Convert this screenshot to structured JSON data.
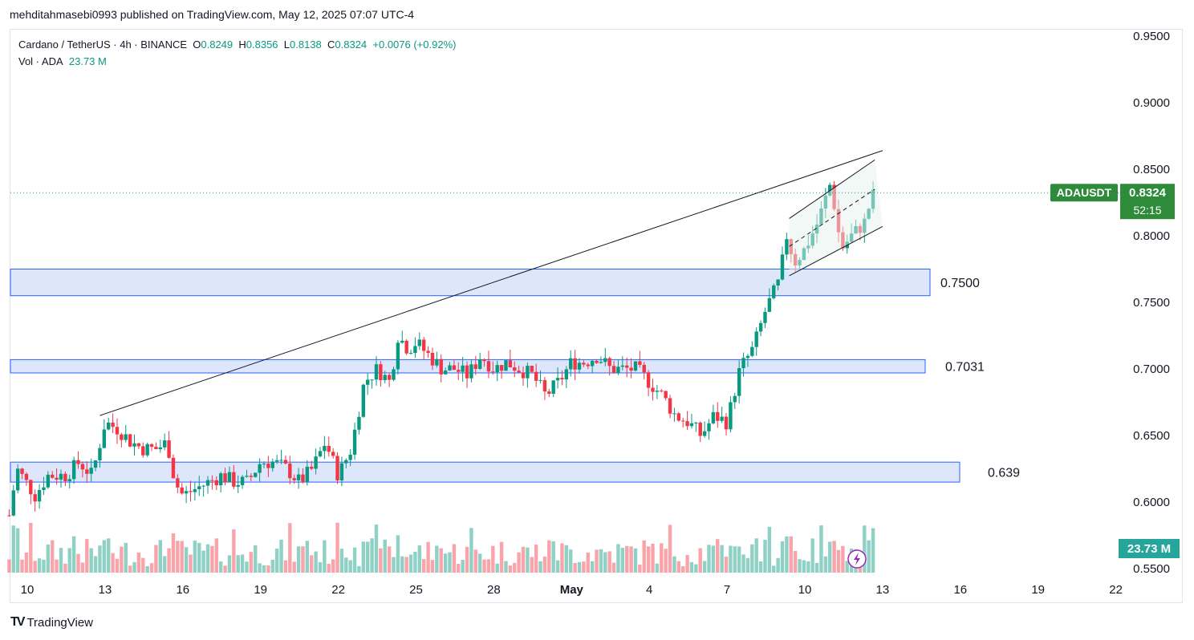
{
  "header": {
    "publisher": "mehditahmasebi0993 published on TradingView.com, May 12, 2025 07:07 UTC-4"
  },
  "legend": {
    "symbol": "Cardano / TetherUS · 4h · BINANCE",
    "o_label": "O",
    "o": "0.8249",
    "h_label": "H",
    "h": "0.8356",
    "l_label": "L",
    "l": "0.8138",
    "c_label": "C",
    "c": "0.8324",
    "change": "+0.0076 (+0.92%)",
    "vol_label": "Vol · ADA",
    "vol": "23.73 M"
  },
  "footer": {
    "brand": "TradingView"
  },
  "colors": {
    "up": "#089981",
    "down": "#f23645",
    "zone_fill": "#d6e0fb",
    "zone_border": "#2962ff",
    "tag": "#2e8b3a"
  },
  "chart_data": {
    "type": "candlestick",
    "symbol": "ADAUSDT",
    "timeframe": "4h",
    "y_ticks": [
      "0.9500",
      "0.9000",
      "0.8500",
      "0.8000",
      "0.7500",
      "0.7000",
      "0.6500",
      "0.6000",
      "0.5500"
    ],
    "ylim": [
      0.55,
      0.955
    ],
    "x_ticks": [
      {
        "label": "10",
        "day": 10
      },
      {
        "label": "13",
        "day": 13
      },
      {
        "label": "16",
        "day": 16
      },
      {
        "label": "19",
        "day": 19
      },
      {
        "label": "22",
        "day": 22
      },
      {
        "label": "25",
        "day": 25
      },
      {
        "label": "28",
        "day": 28
      },
      {
        "label": "May",
        "day": 31
      },
      {
        "label": "4",
        "day": 34
      },
      {
        "label": "7",
        "day": 37
      },
      {
        "label": "10",
        "day": 40
      },
      {
        "label": "13",
        "day": 43
      },
      {
        "label": "16",
        "day": 46
      },
      {
        "label": "19",
        "day": 49
      },
      {
        "label": "22",
        "day": 52
      }
    ],
    "price_anchors": [
      [
        9.3,
        0.59
      ],
      [
        9.6,
        0.625
      ],
      [
        10.3,
        0.605
      ],
      [
        10.8,
        0.62
      ],
      [
        11.5,
        0.62
      ],
      [
        12,
        0.63
      ],
      [
        12.5,
        0.62
      ],
      [
        13,
        0.66
      ],
      [
        13.5,
        0.655
      ],
      [
        14,
        0.645
      ],
      [
        14.5,
        0.64
      ],
      [
        15,
        0.64
      ],
      [
        15.4,
        0.645
      ],
      [
        15.7,
        0.615
      ],
      [
        16,
        0.605
      ],
      [
        16.5,
        0.61
      ],
      [
        17,
        0.615
      ],
      [
        17.5,
        0.62
      ],
      [
        18,
        0.615
      ],
      [
        18.5,
        0.615
      ],
      [
        19,
        0.63
      ],
      [
        19.5,
        0.63
      ],
      [
        20,
        0.625
      ],
      [
        20.5,
        0.615
      ],
      [
        21,
        0.625
      ],
      [
        21.5,
        0.645
      ],
      [
        22,
        0.62
      ],
      [
        22.5,
        0.64
      ],
      [
        23,
        0.69
      ],
      [
        23.5,
        0.7
      ],
      [
        24,
        0.69
      ],
      [
        24.3,
        0.725
      ],
      [
        24.7,
        0.715
      ],
      [
        25,
        0.72
      ],
      [
        25.5,
        0.71
      ],
      [
        26,
        0.7
      ],
      [
        26.5,
        0.7
      ],
      [
        27,
        0.695
      ],
      [
        27.5,
        0.71
      ],
      [
        28,
        0.7
      ],
      [
        28.5,
        0.705
      ],
      [
        29,
        0.7
      ],
      [
        29.5,
        0.695
      ],
      [
        30,
        0.68
      ],
      [
        30.5,
        0.69
      ],
      [
        31,
        0.705
      ],
      [
        31.5,
        0.705
      ],
      [
        32,
        0.71
      ],
      [
        32.5,
        0.7
      ],
      [
        33,
        0.7
      ],
      [
        33.5,
        0.7
      ],
      [
        34,
        0.69
      ],
      [
        34.5,
        0.68
      ],
      [
        35,
        0.665
      ],
      [
        35.5,
        0.66
      ],
      [
        36,
        0.65
      ],
      [
        36.5,
        0.665
      ],
      [
        37,
        0.66
      ],
      [
        37.5,
        0.7
      ],
      [
        38,
        0.715
      ],
      [
        38.5,
        0.745
      ],
      [
        39,
        0.765
      ],
      [
        39.3,
        0.8
      ],
      [
        39.6,
        0.78
      ],
      [
        40,
        0.79
      ],
      [
        40.5,
        0.81
      ],
      [
        41,
        0.84
      ],
      [
        41.4,
        0.79
      ],
      [
        41.8,
        0.8
      ],
      [
        42.3,
        0.81
      ],
      [
        42.6,
        0.83
      ]
    ],
    "volume": {
      "last": "23.73 M"
    },
    "zones": [
      {
        "low": 0.755,
        "high": 0.775,
        "label": "0.7500"
      },
      {
        "low": 0.697,
        "high": 0.707,
        "label": "0.7031"
      },
      {
        "low": 0.615,
        "high": 0.63,
        "label": "0.639"
      }
    ],
    "trendline": {
      "from": {
        "day": 12.8,
        "price": 0.665
      },
      "to": {
        "day": 43.0,
        "price": 0.864
      }
    },
    "channel": {
      "upper": {
        "from": {
          "day": 39.4,
          "price": 0.813
        },
        "to": {
          "day": 42.7,
          "price": 0.857
        }
      },
      "middle": {
        "from": {
          "day": 39.4,
          "price": 0.792
        },
        "to": {
          "day": 42.7,
          "price": 0.835
        }
      },
      "lower": {
        "from": {
          "day": 39.4,
          "price": 0.77
        },
        "to": {
          "day": 43.0,
          "price": 0.807
        }
      }
    },
    "last_price": {
      "symbol": "ADAUSDT",
      "value": "0.8324",
      "countdown": "52:15"
    }
  }
}
